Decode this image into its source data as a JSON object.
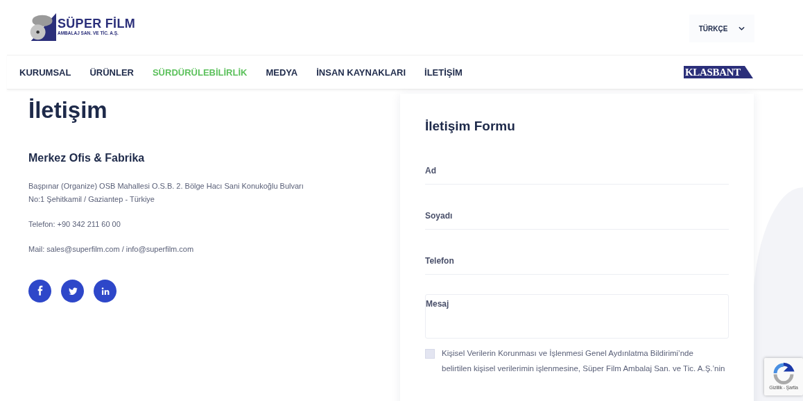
{
  "header": {
    "logo": {
      "title": "SÜPER FİLM",
      "subtitle": "AMBALAJ SAN. VE TİC. A.Ş."
    },
    "language": "TÜRKÇE"
  },
  "nav": [
    {
      "label": "KURUMSAL",
      "selected": false
    },
    {
      "label": "ÜRÜNLER",
      "selected": false
    },
    {
      "label": "SÜRDÜRÜLEBİLİRLİK",
      "selected": true
    },
    {
      "label": "MEDYA",
      "selected": false
    },
    {
      "label": "İNSAN KAYNAKLARI",
      "selected": false
    },
    {
      "label": "İLETİŞİM",
      "selected": false
    }
  ],
  "partner_logo": "KLASBANT",
  "page_title": "İletişim",
  "office": {
    "heading": "Merkez Ofis & Fabrika",
    "address": [
      "Başpınar (Organize) OSB Mahallesi O.S.B. 2. Bölge Hacı Sani Konukoğlu Bulvarı",
      "No:1 Şehitkamil / Gaziantep - Türkiye"
    ],
    "phone": "Telefon: +90 342 211 60 00",
    "mail": "Mail: sales@superfilm.com / info@superfilm.com"
  },
  "social": [
    {
      "kind": "facebook"
    },
    {
      "kind": "twitter"
    },
    {
      "kind": "linkedin"
    }
  ],
  "form": {
    "title": "İletişim Formu",
    "fields": [
      {
        "kind": "line",
        "placeholder": "Ad"
      },
      {
        "kind": "line",
        "placeholder": "Soyadı"
      },
      {
        "kind": "line",
        "placeholder": "Telefon"
      },
      {
        "kind": "area",
        "placeholder": "Mesaj"
      }
    ],
    "consent": {
      "checked": false,
      "lines": [
        "Kişisel Verilerin Korunması ve İşlenmesi Genel Aydınlatma Bildirimi’nde",
        "belirtilen kişisel verilerimin işlenmesine, Süper Film Ambalaj San. ve Tic. A.Ş.’nin"
      ]
    }
  },
  "recaptcha": {
    "text": "Gizlilik - Şartla"
  }
}
